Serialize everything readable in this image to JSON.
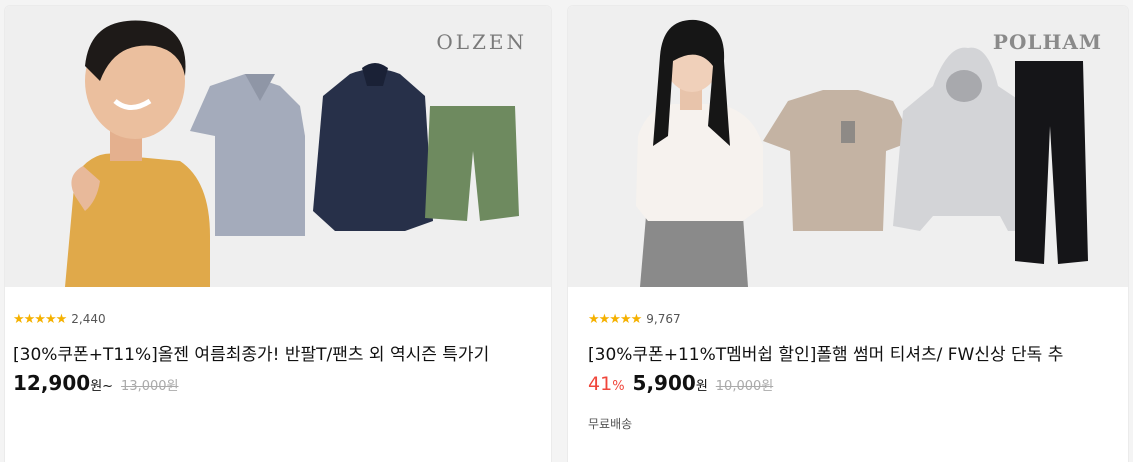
{
  "products": [
    {
      "brand": "OLZEN",
      "stars": "★★★★★",
      "review_count": "2,440",
      "title": "[30%쿠폰+T11%]올젠 여름최종가! 반팔T/팬츠 외 역시즌 특가기",
      "price": "12,900",
      "unit": "원~",
      "original_price": "13,000원"
    },
    {
      "brand": "POLHAM",
      "stars": "★★★★★",
      "review_count": "9,767",
      "title": "[30%쿠폰+11%T멤버쉽 할인]폴햄 썸머 티셔츠/ FW신상 단독 추",
      "discount": "41",
      "discount_unit": "%",
      "price": "5,900",
      "unit": "원",
      "original_price": "10,000원",
      "shipping": "무료배송"
    }
  ],
  "colors": {
    "star": "#f5b100",
    "discount": "#f0463b"
  }
}
